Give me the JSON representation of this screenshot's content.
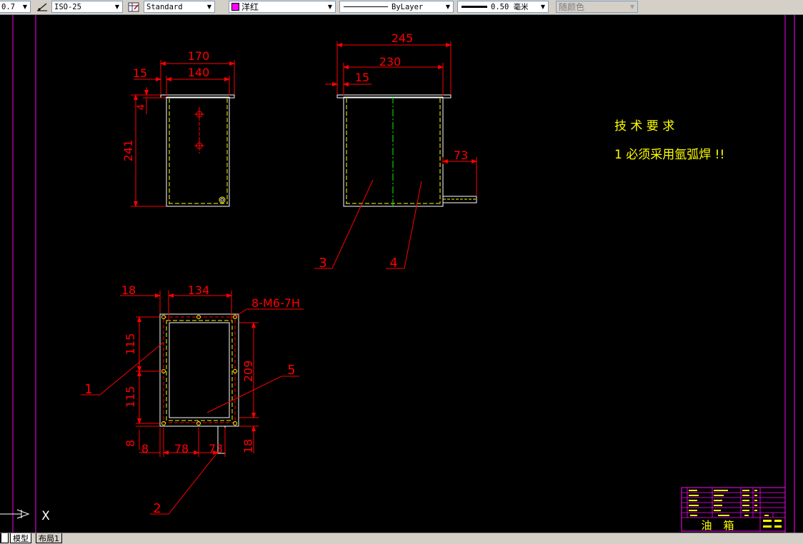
{
  "toolbar": {
    "lineweight_value": "0.7",
    "dimstyle_value": "ISO-25",
    "tablestyle_value": "Standard",
    "color_value": "洋红",
    "color_swatch": "#ff00ff",
    "linetype_value": "ByLayer",
    "lineweight2_value": "0.50 毫米",
    "plotstyle_value": "随颜色"
  },
  "drawing": {
    "front_view": {
      "dim_total_width": "170",
      "dim_inner_width": "140",
      "dim_left_offset": "15",
      "dim_top": "4",
      "dim_height": "241"
    },
    "side_view": {
      "dim_total_width": "245",
      "dim_inner_width": "230",
      "dim_left_offset": "15",
      "dim_pipe": "73"
    },
    "top_view": {
      "dim_left": "18",
      "dim_width": "134",
      "dim_hole_spec": "8-M6-7H",
      "dim_left_upper": "115",
      "dim_left_lower": "115",
      "dim_right_height": "209",
      "dim_bottom_left": "8",
      "dim_bottom_mid1": "8",
      "dim_bottom_mid2": "78",
      "dim_bottom_mid3": "73",
      "dim_bottom_right": "18"
    },
    "balloons": {
      "b1": "1",
      "b2": "2",
      "b3": "3",
      "b4": "4",
      "b5": "5"
    },
    "notes": {
      "title": "技 术 要 求",
      "line1": "1 必须采用氩弧焊 !!"
    },
    "title_block": {
      "part_name_1": "油",
      "part_name_2": "箱"
    },
    "ucs_label": "X"
  },
  "tabs": {
    "partial": "▏",
    "model": "模型",
    "layout1": "布局1"
  },
  "colors": {
    "red": "#ff0000",
    "yellow": "#ffff00",
    "white": "#ffffff",
    "magenta": "#ff00ff",
    "green": "#00ff00"
  }
}
